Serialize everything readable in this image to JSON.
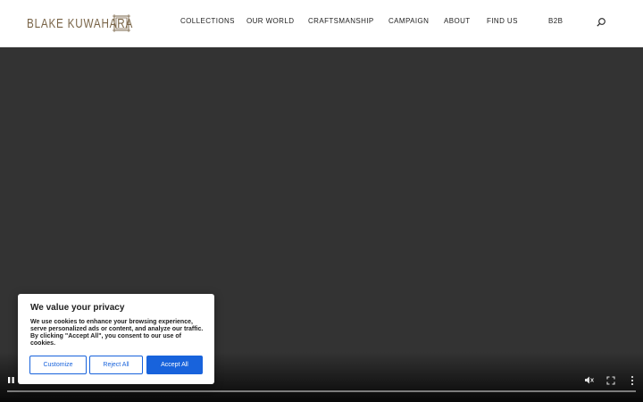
{
  "header": {
    "logo_text": "BLAKE KUWAHARA",
    "nav": [
      "COLLECTIONS",
      "OUR WORLD",
      "CRAFTSMANSHIP",
      "CAMPAIGN",
      "ABOUT",
      "FIND US",
      "B2B"
    ],
    "search_icon": "search-icon"
  },
  "video": {
    "controls": [
      "pause-icon",
      "mute-icon",
      "fullscreen-icon",
      "more-options-icon"
    ]
  },
  "cookie_banner": {
    "title": "We value your privacy",
    "text": "We use cookies to enhance your browsing experience, serve personalized ads or content, and analyze our traffic. By clicking \"Accept All\", you consent to our use of cookies.",
    "buttons": {
      "customize": "Customize",
      "reject": "Reject All",
      "accept": "Accept All"
    }
  },
  "colors": {
    "brand": "#7a6548",
    "accent": "#1863dc",
    "video_background": "#333333"
  }
}
